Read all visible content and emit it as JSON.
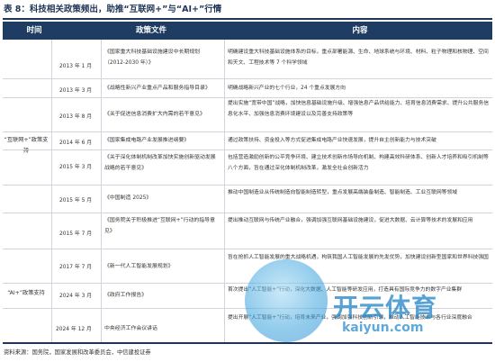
{
  "title": "表 8：科技相关政策频出，助推“互联网+”与“AI+”行情",
  "header": {
    "col_time": "时间",
    "col_doc": "政策文件",
    "col_content": "内容"
  },
  "groups": [
    {
      "label": "“互联网+”政策支持"
    },
    {
      "label": "“AI+”政策支持"
    }
  ],
  "rows": [
    {
      "date": "2013 年 1 月",
      "doc": "《国家重大科技基础设施建设中长期规划（2012-2030 年）》",
      "content": "明确建设重大科技基础设施体系的目标，重点部署能源、生命、地球系统与环境、材料、粒子物理和核物理、空间和天文、工程技术等 7 个科学领域"
    },
    {
      "date": "2013 年 3 月",
      "doc": "《战略性新兴产业重点产品和服务指导目录》",
      "content": "明确战略新兴产业的七个行业，24 个重点发展方向"
    },
    {
      "date": "2013 年 8 月",
      "doc": "《关于促进信息消费扩大内需的若干意见》",
      "content": "提出实施“宽带中国”战略，加快信息基础设施升级、增强信息产品供给能力、培育信息消费需求、提升公共服务信息化水平、加强信息消费环境建设以及完善支持政策等"
    },
    {
      "date": "2014 年 6 月",
      "doc": "《国家集成电路产业发展推进纲要》",
      "content": "通过政策扶持、资金投入等方式促进集成电路产业快速发展，提升自主创新能力与技术突破"
    },
    {
      "date": "2015 年 3 月",
      "doc": "《关于深化体制机制改革加快实施创新驱动发展战略的若干意见》",
      "content": "包括营造激励创新的公平竞争环境、建立技术创新市场导向机制、构建高效科研体系、创新人才培养和吸引机制等八个方面，旨在通过深化体制机制改革，激发全社会创新活力"
    },
    {
      "date": "2015 年 5 月",
      "doc": "《中国制造 2025》",
      "content": "推动中国制造业从传统制造向智能制造转型，重点发展高端装备制造、智能制造、工业互联网等领域"
    },
    {
      "date": "2015 年 7 月",
      "doc": "《国务院关于积极推进“互联网+”行动的指导意见》",
      "content": "提出推动互联网与传统产业融合，强调加强互联网基础设施建设，促进大数据、云计算等技术的发展和应用"
    },
    {
      "date": "2017 年 7 月",
      "doc": "《新一代人工智能发展规划》",
      "content": "旨在抢抓人工智能发展的重大战略机遇，构筑我国人工智能发展的先发优势，加快建设创新型国家和世界科技强国"
    },
    {
      "date": "2024 年 3 月",
      "doc": "《政府工作报告》",
      "content": "首次提出“人工智能+”行动，深化大数据、人工智能等研发应用，打造具有国际竞争力的数字产业集群"
    },
    {
      "date": "2024 年 12 月",
      "doc": "中央经济工作会议讲话",
      "content": "提出开展“人工智能+”行动，培育未来产业，强调加强科技创新引领，推动人工智能技术与各行业深度融合"
    }
  ],
  "source": "资料来源：国务院，国家发展和改革委员会，中信建投证券",
  "watermark": {
    "brand": "开云体育",
    "url": "kaiyun.com"
  }
}
